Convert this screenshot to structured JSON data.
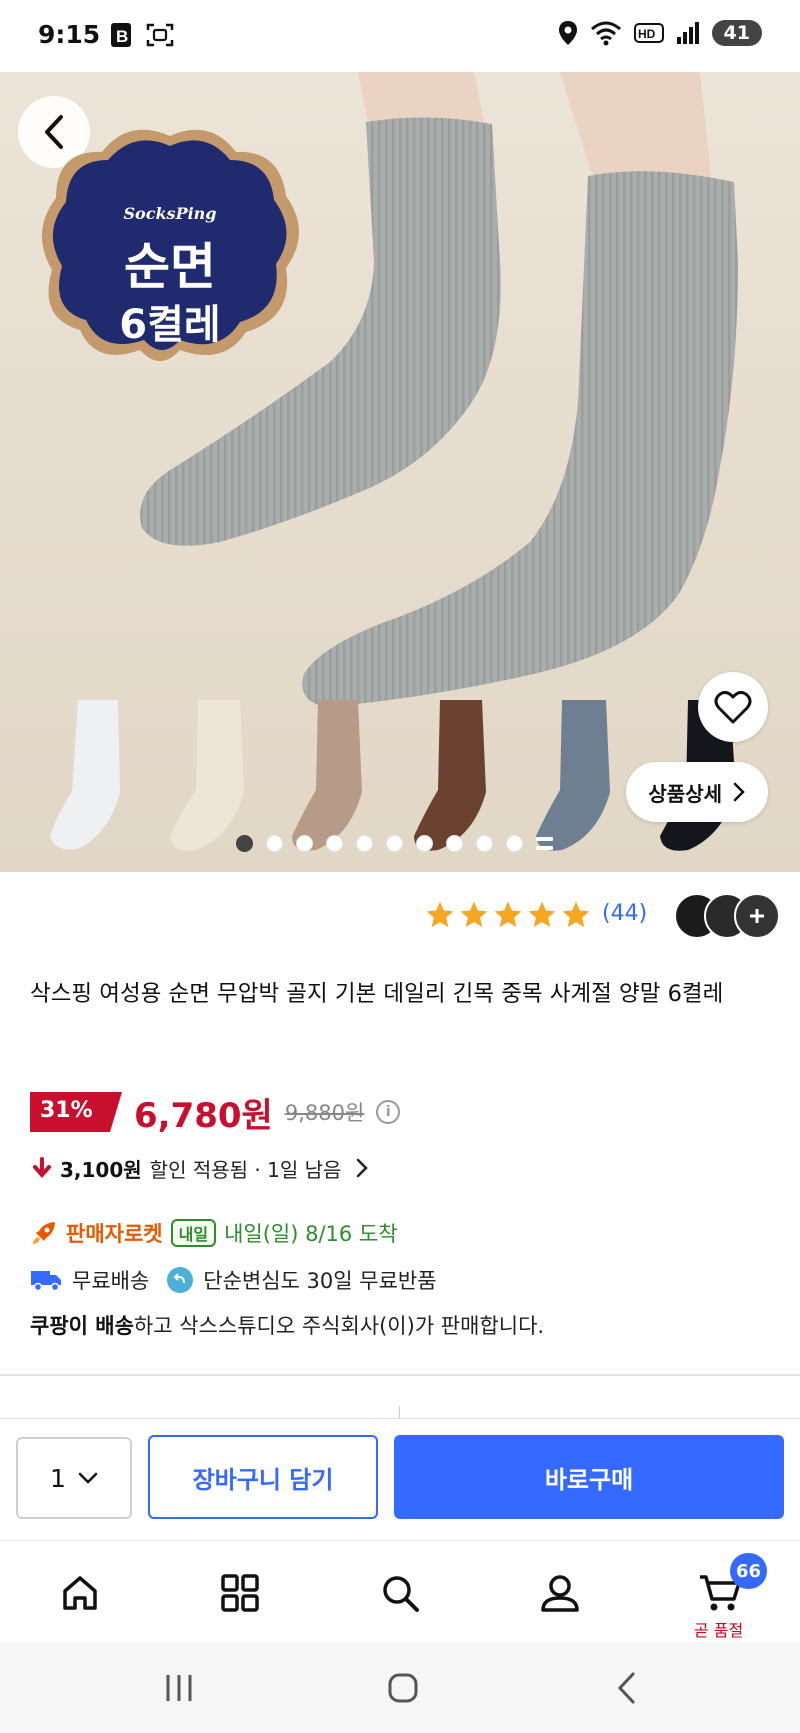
{
  "status_bar": {
    "time": "9:15",
    "battery": "41"
  },
  "hero": {
    "badge": {
      "brand": "SocksPing",
      "line1": "순면",
      "line2": "6켤레"
    },
    "detail_button": "상품상세",
    "carousel": {
      "total": 10,
      "active_index": 0
    }
  },
  "rating": {
    "stars": 5,
    "count": "(44)"
  },
  "product": {
    "title": "삭스핑 여성용 순면 무압박 골지 기본 데일리 긴목 중목 사계절 양말 6켤레",
    "discount": "31%",
    "price": "6,780원",
    "original_price": "9,880원",
    "saving_amount": "3,100원",
    "saving_text": "할인 적용됨 · 1일 남음"
  },
  "delivery": {
    "rocket_label": "판매자로켓",
    "tomorrow_badge": "내일",
    "arrival": "내일(일) 8/16 도착",
    "free_shipping": "무료배송",
    "return_policy": "단순변심도 30일 무료반품",
    "seller_bold": "쿠팡이 배송",
    "seller_rest": "하고 삭스스튜디오 주식회사(이)가 판매합니다."
  },
  "purchase": {
    "quantity": "1",
    "cart_button": "장바구니 담기",
    "buy_button": "바로구매"
  },
  "bottom_nav": {
    "cart_count": "66",
    "cart_caption": "곧 품절"
  },
  "colors": {
    "accent": "#346aff",
    "price": "#c8102e",
    "rocket": "#e85a00",
    "delivery_green": "#2e8b2e",
    "star": "#f5a623"
  }
}
